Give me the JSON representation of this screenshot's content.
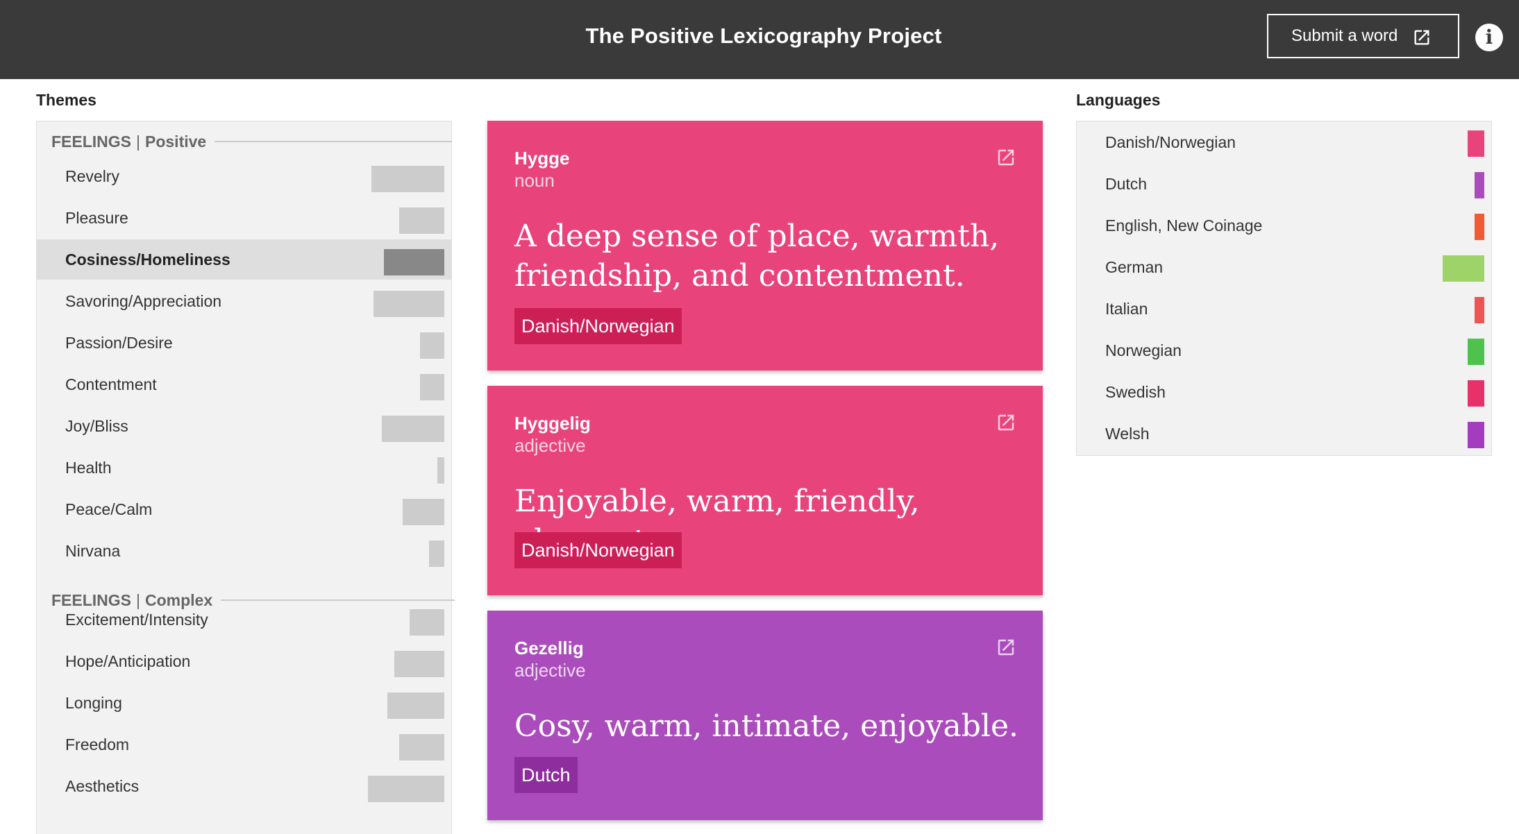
{
  "header": {
    "title": "The Positive Lexicography Project",
    "submit_label": "Submit a word",
    "info_symbol": "i"
  },
  "themes": {
    "heading": "Themes",
    "groups": [
      {
        "category": "FEELINGS",
        "separator": "|",
        "name": "Positive",
        "items": [
          {
            "label": "Revelry",
            "count": 42,
            "selected": false
          },
          {
            "label": "Pleasure",
            "count": 26,
            "selected": false
          },
          {
            "label": "Cosiness/Homeliness",
            "count": 35,
            "selected": true
          },
          {
            "label": "Savoring/Appreciation",
            "count": 41,
            "selected": false
          },
          {
            "label": "Passion/Desire",
            "count": 14,
            "selected": false
          },
          {
            "label": "Contentment",
            "count": 14,
            "selected": false
          },
          {
            "label": "Joy/Bliss",
            "count": 36,
            "selected": false
          },
          {
            "label": "Health",
            "count": 4,
            "selected": false
          },
          {
            "label": "Peace/Calm",
            "count": 24,
            "selected": false
          },
          {
            "label": "Nirvana",
            "count": 9,
            "selected": false
          }
        ]
      },
      {
        "category": "FEELINGS",
        "separator": "|",
        "name": "Complex",
        "items": [
          {
            "label": "Excitement/Intensity",
            "count": 20,
            "selected": false
          },
          {
            "label": "Hope/Anticipation",
            "count": 29,
            "selected": false
          },
          {
            "label": "Longing",
            "count": 33,
            "selected": false
          },
          {
            "label": "Freedom",
            "count": 26,
            "selected": false
          },
          {
            "label": "Aesthetics",
            "count": 44,
            "selected": false
          }
        ]
      }
    ]
  },
  "cards": [
    {
      "word": "Hygge",
      "part_of_speech": "noun",
      "definition": "A deep sense of place, warmth, friendship, and contentment.",
      "language": "Danish/Norwegian",
      "color": "#e8437b",
      "tag_color": "#cc1f56"
    },
    {
      "word": "Hyggelig",
      "part_of_speech": "adjective",
      "definition": "Enjoyable, warm, friendly, pleasant.",
      "language": "Danish/Norwegian",
      "color": "#e8437b",
      "tag_color": "#cc1f56"
    },
    {
      "word": "Gezellig",
      "part_of_speech": "adjective",
      "definition": "Cosy, warm, intimate, enjoyable.",
      "language": "Dutch",
      "color": "#ab4cbc",
      "tag_color": "#8e2e9e"
    }
  ],
  "languages": {
    "heading": "Languages",
    "items": [
      {
        "label": "Danish/Norwegian",
        "count": 2,
        "color": "#e8437b"
      },
      {
        "label": "Dutch",
        "count": 1,
        "color": "#ab4cbc"
      },
      {
        "label": "English, New Coinage",
        "count": 1,
        "color": "#f15a35"
      },
      {
        "label": "German",
        "count": 5,
        "color": "#9ed36a"
      },
      {
        "label": "Italian",
        "count": 1,
        "color": "#ef5454"
      },
      {
        "label": "Norwegian",
        "count": 2,
        "color": "#4dc34d"
      },
      {
        "label": "Swedish",
        "count": 2,
        "color": "#e8306a"
      },
      {
        "label": "Welsh",
        "count": 2,
        "color": "#a43cbf"
      }
    ]
  }
}
